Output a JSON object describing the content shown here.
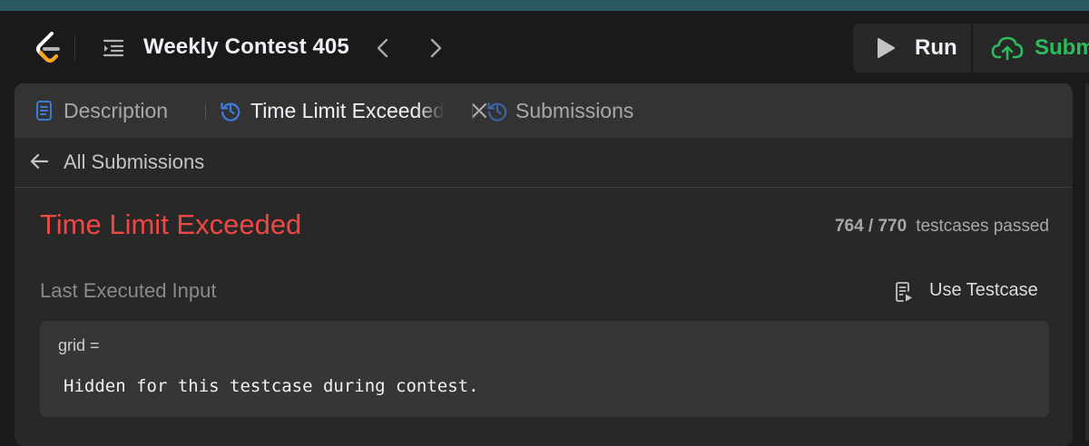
{
  "navbar": {
    "logo_icon": "leetcode-logo",
    "list_icon": "problem-list-icon",
    "contest_title": "Weekly Contest 405",
    "prev_icon": "chevron-left-icon",
    "next_icon": "chevron-right-icon"
  },
  "actions": {
    "run_label": "Run",
    "submit_label": "Subm",
    "submit_color": "#2cbb5d"
  },
  "tabs": [
    {
      "label": "Description",
      "icon": "description-icon"
    },
    {
      "label": "Time Limit Exceeded",
      "icon": "history-icon",
      "active": true
    },
    {
      "label": "Submissions",
      "icon": "history-icon"
    }
  ],
  "back": {
    "label": "All Submissions"
  },
  "result": {
    "status": "Time Limit Exceeded",
    "status_color": "#ef4743",
    "passed_count": "764 / 770",
    "passed_text": "testcases passed"
  },
  "input": {
    "heading": "Last Executed Input",
    "use_testcase_label": "Use Testcase",
    "variable": "grid =",
    "value": "Hidden for this testcase during contest."
  }
}
